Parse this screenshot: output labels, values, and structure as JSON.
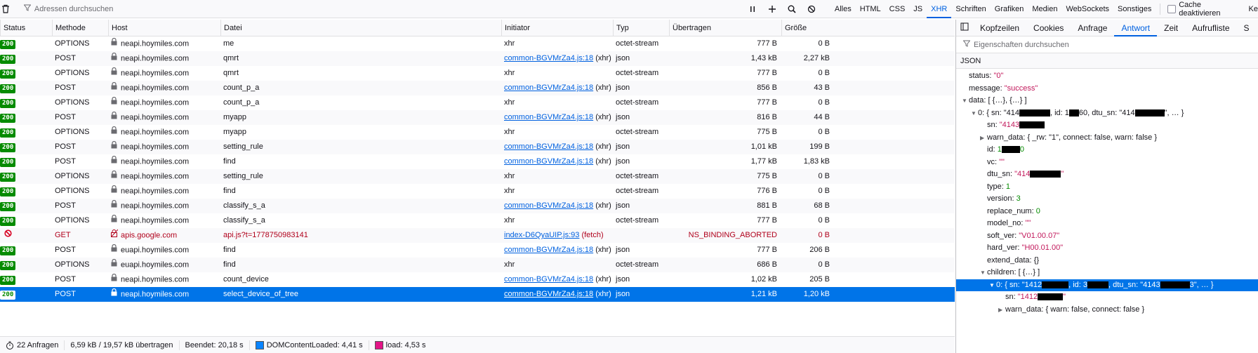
{
  "toolbar": {
    "filter_placeholder": "Adressen durchsuchen",
    "filters": [
      "Alles",
      "HTML",
      "CSS",
      "JS",
      "XHR",
      "Schriften",
      "Grafiken",
      "Medien",
      "WebSockets",
      "Sonstiges"
    ],
    "active_filter": "XHR",
    "cache_label": "Cache deaktivieren",
    "cut_label": "Ke"
  },
  "columns": [
    "Status",
    "Methode",
    "Host",
    "Datei",
    "Initiator",
    "Typ",
    "Übertragen",
    "Größe"
  ],
  "rows": [
    {
      "status": "200",
      "method": "OPTIONS",
      "host": "neapi.hoymiles.com",
      "file": "me",
      "initiator": "xhr",
      "initiator_link": "",
      "type": "octet-stream",
      "transferred": "777 B",
      "size": "0 B"
    },
    {
      "status": "200",
      "method": "POST",
      "host": "neapi.hoymiles.com",
      "file": "qmrt",
      "initiator": " (xhr)",
      "initiator_link": "common-BGVMrZa4.js:18",
      "type": "json",
      "transferred": "1,43 kB",
      "size": "2,27 kB"
    },
    {
      "status": "200",
      "method": "OPTIONS",
      "host": "neapi.hoymiles.com",
      "file": "qmrt",
      "initiator": "xhr",
      "initiator_link": "",
      "type": "octet-stream",
      "transferred": "777 B",
      "size": "0 B"
    },
    {
      "status": "200",
      "method": "POST",
      "host": "neapi.hoymiles.com",
      "file": "count_p_a",
      "initiator": " (xhr)",
      "initiator_link": "common-BGVMrZa4.js:18",
      "type": "json",
      "transferred": "856 B",
      "size": "43 B"
    },
    {
      "status": "200",
      "method": "OPTIONS",
      "host": "neapi.hoymiles.com",
      "file": "count_p_a",
      "initiator": "xhr",
      "initiator_link": "",
      "type": "octet-stream",
      "transferred": "777 B",
      "size": "0 B"
    },
    {
      "status": "200",
      "method": "POST",
      "host": "neapi.hoymiles.com",
      "file": "myapp",
      "initiator": " (xhr)",
      "initiator_link": "common-BGVMrZa4.js:18",
      "type": "json",
      "transferred": "816 B",
      "size": "44 B"
    },
    {
      "status": "200",
      "method": "OPTIONS",
      "host": "neapi.hoymiles.com",
      "file": "myapp",
      "initiator": "xhr",
      "initiator_link": "",
      "type": "octet-stream",
      "transferred": "775 B",
      "size": "0 B"
    },
    {
      "status": "200",
      "method": "POST",
      "host": "neapi.hoymiles.com",
      "file": "setting_rule",
      "initiator": " (xhr)",
      "initiator_link": "common-BGVMrZa4.js:18",
      "type": "json",
      "transferred": "1,01 kB",
      "size": "199 B"
    },
    {
      "status": "200",
      "method": "POST",
      "host": "neapi.hoymiles.com",
      "file": "find",
      "initiator": " (xhr)",
      "initiator_link": "common-BGVMrZa4.js:18",
      "type": "json",
      "transferred": "1,77 kB",
      "size": "1,83 kB"
    },
    {
      "status": "200",
      "method": "OPTIONS",
      "host": "neapi.hoymiles.com",
      "file": "setting_rule",
      "initiator": "xhr",
      "initiator_link": "",
      "type": "octet-stream",
      "transferred": "775 B",
      "size": "0 B"
    },
    {
      "status": "200",
      "method": "OPTIONS",
      "host": "neapi.hoymiles.com",
      "file": "find",
      "initiator": "xhr",
      "initiator_link": "",
      "type": "octet-stream",
      "transferred": "776 B",
      "size": "0 B"
    },
    {
      "status": "200",
      "method": "POST",
      "host": "neapi.hoymiles.com",
      "file": "classify_s_a",
      "initiator": " (xhr)",
      "initiator_link": "common-BGVMrZa4.js:18",
      "type": "json",
      "transferred": "881 B",
      "size": "68 B"
    },
    {
      "status": "200",
      "method": "OPTIONS",
      "host": "neapi.hoymiles.com",
      "file": "classify_s_a",
      "initiator": "xhr",
      "initiator_link": "",
      "type": "octet-stream",
      "transferred": "777 B",
      "size": "0 B"
    },
    {
      "status": "error",
      "method": "GET",
      "host": "apis.google.com",
      "file": "api.js?t=1778750983141",
      "initiator": " (fetch)",
      "initiator_link": "index-D6QyaUIP.js:93",
      "type": "",
      "transferred": "NS_BINDING_ABORTED",
      "size": "0 B"
    },
    {
      "status": "200",
      "method": "POST",
      "host": "euapi.hoymiles.com",
      "file": "find",
      "initiator": " (xhr)",
      "initiator_link": "common-BGVMrZa4.js:18",
      "type": "json",
      "transferred": "777 B",
      "size": "206 B"
    },
    {
      "status": "200",
      "method": "OPTIONS",
      "host": "euapi.hoymiles.com",
      "file": "find",
      "initiator": "xhr",
      "initiator_link": "",
      "type": "octet-stream",
      "transferred": "686 B",
      "size": "0 B"
    },
    {
      "status": "200",
      "method": "POST",
      "host": "neapi.hoymiles.com",
      "file": "count_device",
      "initiator": " (xhr)",
      "initiator_link": "common-BGVMrZa4.js:18",
      "type": "json",
      "transferred": "1,02 kB",
      "size": "205 B"
    },
    {
      "status": "200",
      "method": "POST",
      "host": "neapi.hoymiles.com",
      "file": "select_device_of_tree",
      "initiator": " (xhr)",
      "initiator_link": "common-BGVMrZa4.js:18",
      "type": "json",
      "transferred": "1,21 kB",
      "size": "1,20 kB",
      "selected": true
    }
  ],
  "footer": {
    "requests": "22 Anfragen",
    "transferred": "6,59 kB / 19,57 kB übertragen",
    "finished": "Beendet: 20,18 s",
    "dcl": "DOMContentLoaded: 4,41 s",
    "load": "load: 4,53 s",
    "dcl_color": "#0a84ff",
    "load_color": "#e31587"
  },
  "panel": {
    "tabs": [
      "Kopfzeilen",
      "Cookies",
      "Anfrage",
      "Antwort",
      "Zeit",
      "Aufrufliste",
      "S"
    ],
    "active_tab": "Antwort",
    "filter_placeholder": "Eigenschaften durchsuchen",
    "json_label": "JSON",
    "tree": [
      {
        "indent": 0,
        "tw": "",
        "key": "status:",
        "val": "\"0\"",
        "cls": "str"
      },
      {
        "indent": 0,
        "tw": "",
        "key": "message:",
        "val": "\"success\"",
        "cls": "str"
      },
      {
        "indent": 0,
        "tw": "▼",
        "key": "data:",
        "val": "[ {…}, {…} ]",
        "cls": ""
      },
      {
        "indent": 1,
        "tw": "▼",
        "key": "0:",
        "val": "{ sn: \"414",
        "val2": ", id: 1",
        "val3": "60, dtu_sn: \"414",
        "val4": "\", … }",
        "cls": "",
        "redacts": [
          44,
          14,
          42
        ]
      },
      {
        "indent": 2,
        "tw": "",
        "key": "sn:",
        "val": "\"4143",
        "cls": "str",
        "redacts": [
          36
        ]
      },
      {
        "indent": 2,
        "tw": "▶",
        "key": "warn_data:",
        "val": "{ _rw: \"1\", connect: false, warn: false }",
        "cls": ""
      },
      {
        "indent": 2,
        "tw": "",
        "key": "id:",
        "val": "1",
        "val2": "0",
        "cls": "num",
        "redacts": [
          26
        ]
      },
      {
        "indent": 2,
        "tw": "",
        "key": "vc:",
        "val": "\"\"",
        "cls": "str"
      },
      {
        "indent": 2,
        "tw": "",
        "key": "dtu_sn:",
        "val": "\"414",
        "val2": "\"",
        "cls": "str",
        "redacts": [
          44
        ]
      },
      {
        "indent": 2,
        "tw": "",
        "key": "type:",
        "val": "1",
        "cls": "num"
      },
      {
        "indent": 2,
        "tw": "",
        "key": "version:",
        "val": "3",
        "cls": "num"
      },
      {
        "indent": 2,
        "tw": "",
        "key": "replace_num:",
        "val": "0",
        "cls": "num"
      },
      {
        "indent": 2,
        "tw": "",
        "key": "model_no:",
        "val": "\"\"",
        "cls": "str"
      },
      {
        "indent": 2,
        "tw": "",
        "key": "soft_ver:",
        "val": "\"V01.00.07\"",
        "cls": "str"
      },
      {
        "indent": 2,
        "tw": "",
        "key": "hard_ver:",
        "val": "\"H00.01.00\"",
        "cls": "str"
      },
      {
        "indent": 2,
        "tw": "",
        "key": "extend_data:",
        "val": "{}",
        "cls": ""
      },
      {
        "indent": 2,
        "tw": "▼",
        "key": "children:",
        "val": "[ {…} ]",
        "cls": ""
      },
      {
        "indent": 3,
        "tw": "▼",
        "key": "0:",
        "val": "{ sn: \"1412",
        "val2": ", id: 3",
        "val3": ", dtu_sn: \"4143",
        "val4": "3\", … }",
        "cls": "",
        "sel": true,
        "redacts": [
          38,
          30,
          42
        ]
      },
      {
        "indent": 4,
        "tw": "",
        "key": "sn:",
        "val": "\"1412",
        "val2": "\"",
        "cls": "str",
        "redacts": [
          36
        ]
      },
      {
        "indent": 4,
        "tw": "▶",
        "key": "warn_data:",
        "val": "{ warn: false, connect: false }",
        "cls": ""
      }
    ]
  }
}
